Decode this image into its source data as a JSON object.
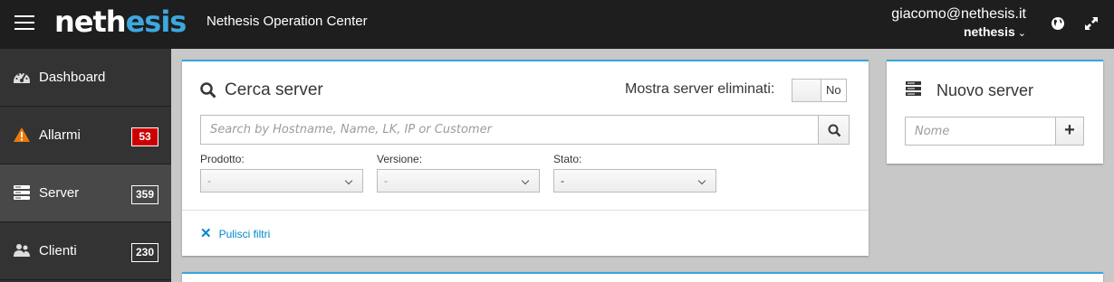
{
  "header": {
    "logo_prefix": "neth",
    "logo_accent": "esis",
    "app_title": "Nethesis Operation Center",
    "user_email": "giacomo@nethesis.it",
    "user_org": "nethesis",
    "icons": [
      "menu-icon",
      "globe-icon",
      "expand-icon"
    ]
  },
  "sidebar": {
    "items": [
      {
        "label": "Dashboard",
        "icon": "dashboard-icon"
      },
      {
        "label": "Allarmi",
        "icon": "warning-icon",
        "badge": "53",
        "badge_color": "#cc0000"
      },
      {
        "label": "Server",
        "icon": "server-icon",
        "badge": "359"
      },
      {
        "label": "Clienti",
        "icon": "users-icon",
        "badge": "230"
      }
    ]
  },
  "search_card": {
    "title": "Cerca server",
    "toggle_label": "Mostra server eliminati:",
    "toggle_value": "No",
    "search_placeholder": "Search by Hostname, Name, LK, IP or Customer",
    "filters": [
      {
        "label": "Prodotto:",
        "value": "-"
      },
      {
        "label": "Versione:",
        "value": "-"
      },
      {
        "label": "Stato:",
        "value": "-"
      }
    ],
    "clear_filters": "Pulisci filtri"
  },
  "new_server_card": {
    "title": "Nuovo server",
    "name_placeholder": "Nome",
    "add_label": "+"
  },
  "colors": {
    "accent": "#39a5dc",
    "link": "#0088ce",
    "danger_badge": "#cc0000",
    "header_bg": "#1e1e1e",
    "sidebar_bg": "#333333"
  }
}
